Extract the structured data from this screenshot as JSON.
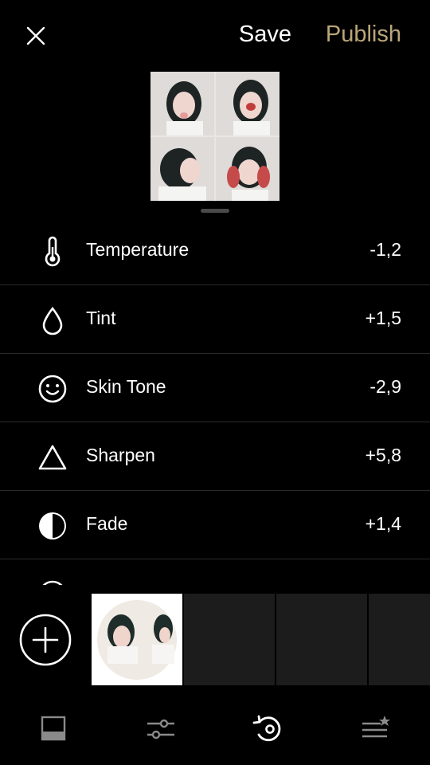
{
  "header": {
    "close_icon": "close-icon",
    "save_label": "Save",
    "publish_label": "Publish",
    "publish_color": "#bba679"
  },
  "adjustments": [
    {
      "icon": "thermometer-icon",
      "label": "Temperature",
      "value": "-1,2"
    },
    {
      "icon": "drop-icon",
      "label": "Tint",
      "value": "+1,5"
    },
    {
      "icon": "smiley-icon",
      "label": "Skin Tone",
      "value": "-2,9"
    },
    {
      "icon": "triangle-icon",
      "label": "Sharpen",
      "value": "+5,8"
    },
    {
      "icon": "half-circle-icon",
      "label": "Fade",
      "value": "+1,4"
    }
  ],
  "toolbar": {
    "add_icon": "plus-circle-icon"
  },
  "nav": [
    "preset-icon",
    "sliders-icon",
    "history-icon",
    "recipes-icon"
  ]
}
